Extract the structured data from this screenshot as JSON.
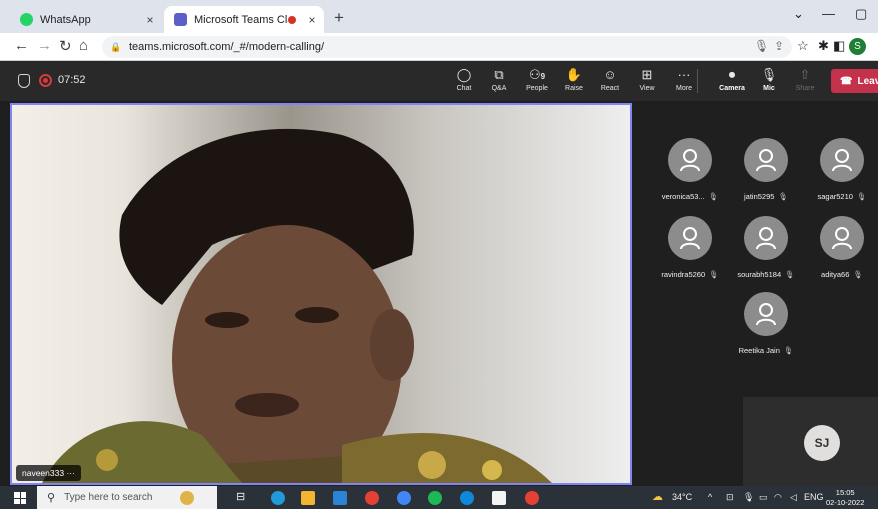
{
  "browser": {
    "tabs": [
      {
        "title": "WhatsApp",
        "icon": "whatsapp-icon",
        "close": "×"
      },
      {
        "title": "Microsoft Teams Classic",
        "icon": "teams-icon",
        "close": "×"
      }
    ],
    "new_tab": "+",
    "window_controls": {
      "minimize": "—",
      "restore": "▢"
    },
    "url": "teams.microsoft.com/_#/modern-calling/",
    "profile_initial": "S"
  },
  "meeting": {
    "duration": "07:52",
    "controls": [
      {
        "name": "chat",
        "label": "Chat",
        "icon": "chat-icon"
      },
      {
        "name": "qa",
        "label": "Q&A",
        "icon": "qa-icon"
      },
      {
        "name": "people",
        "label": "People",
        "icon": "people-icon",
        "count": "9"
      },
      {
        "name": "raise",
        "label": "Raise",
        "icon": "raise-hand-icon"
      },
      {
        "name": "react",
        "label": "React",
        "icon": "smiley-icon"
      },
      {
        "name": "view",
        "label": "View",
        "icon": "view-icon"
      },
      {
        "name": "more",
        "label": "More",
        "icon": "more-icon"
      },
      {
        "name": "camera",
        "label": "Camera",
        "icon": "camera-off-icon"
      },
      {
        "name": "mic",
        "label": "Mic",
        "icon": "mic-off-icon"
      },
      {
        "name": "share",
        "label": "Share",
        "icon": "share-icon"
      }
    ],
    "leave_label": "Leave",
    "accent_color": "#7f85f5",
    "leave_color": "#c4314b"
  },
  "main_video": {
    "name": "naveen333",
    "more": "···"
  },
  "participants": [
    {
      "name": "veronica53..."
    },
    {
      "name": "jatin5295"
    },
    {
      "name": "sagar5210"
    },
    {
      "name": "ravindra5260"
    },
    {
      "name": "sourabh5184"
    },
    {
      "name": "aditya66"
    },
    {
      "name": "Reetika Jain"
    }
  ],
  "self_view": {
    "initials": "SJ"
  },
  "taskbar": {
    "search_placeholder": "Type here to search",
    "weather": "34°C",
    "language": "ENG",
    "time": "15:05",
    "date": "02-10-2022"
  }
}
